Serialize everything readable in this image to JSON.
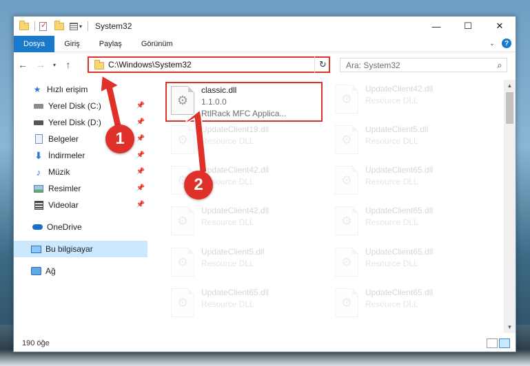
{
  "window": {
    "title": "System32"
  },
  "ribbon": {
    "tabs": [
      "Dosya",
      "Giriş",
      "Paylaş",
      "Görünüm"
    ]
  },
  "address": {
    "path": "C:\\Windows\\System32"
  },
  "search": {
    "placeholder": "Ara: System32"
  },
  "nav": {
    "items": [
      {
        "label": "Hızlı erişim",
        "icon": "star-icon"
      },
      {
        "label": "Yerel Disk (C:)",
        "icon": "drive-icon",
        "pinned": true
      },
      {
        "label": "Yerel Disk (D:)",
        "icon": "drive-icon",
        "pinned": true
      },
      {
        "label": "Belgeler",
        "icon": "document-icon",
        "pinned": true
      },
      {
        "label": "İndirmeler",
        "icon": "download-arrow-icon",
        "pinned": true
      },
      {
        "label": "Müzik",
        "icon": "music-note-icon",
        "pinned": true
      },
      {
        "label": "Resimler",
        "icon": "pictures-icon",
        "pinned": true
      },
      {
        "label": "Videolar",
        "icon": "video-icon",
        "pinned": true
      },
      {
        "label": "OneDrive",
        "icon": "cloud-icon"
      },
      {
        "label": "Bu bilgisayar",
        "icon": "computer-icon",
        "selected": true
      },
      {
        "label": "Ağ",
        "icon": "network-icon"
      }
    ]
  },
  "files": {
    "highlighted": {
      "name": "classic.dll",
      "version": "1.1.0.0",
      "desc": "RtlRack MFC Applica..."
    },
    "left": [
      {
        "name": "UpdateClient19.dll",
        "desc": "Resource DLL"
      },
      {
        "name": "UpdateClient42.dll",
        "desc": "Resource DLL"
      },
      {
        "name": "UpdateClient42.dll",
        "desc": "Resource DLL"
      },
      {
        "name": "UpdateClient5.dll",
        "desc": "Resource DLL"
      },
      {
        "name": "UpdateClient65.dll",
        "desc": "Resource DLL"
      }
    ],
    "right": [
      {
        "name": "UpdateClient42.dll",
        "desc": "Resource DLL"
      },
      {
        "name": "UpdateClient5.dll",
        "desc": "Resource DLL"
      },
      {
        "name": "UpdateClient65.dll",
        "desc": "Resource DLL"
      },
      {
        "name": "UpdateClient65.dll",
        "desc": "Resource DLL"
      },
      {
        "name": "UpdateClient65.dll",
        "desc": "Resource DLL"
      },
      {
        "name": "UpdateClient65.dll",
        "desc": "Resource DLL"
      }
    ]
  },
  "status": {
    "count": "190 öğe"
  },
  "annotations": {
    "step1": "1",
    "step2": "2",
    "color": "#e0302a"
  }
}
